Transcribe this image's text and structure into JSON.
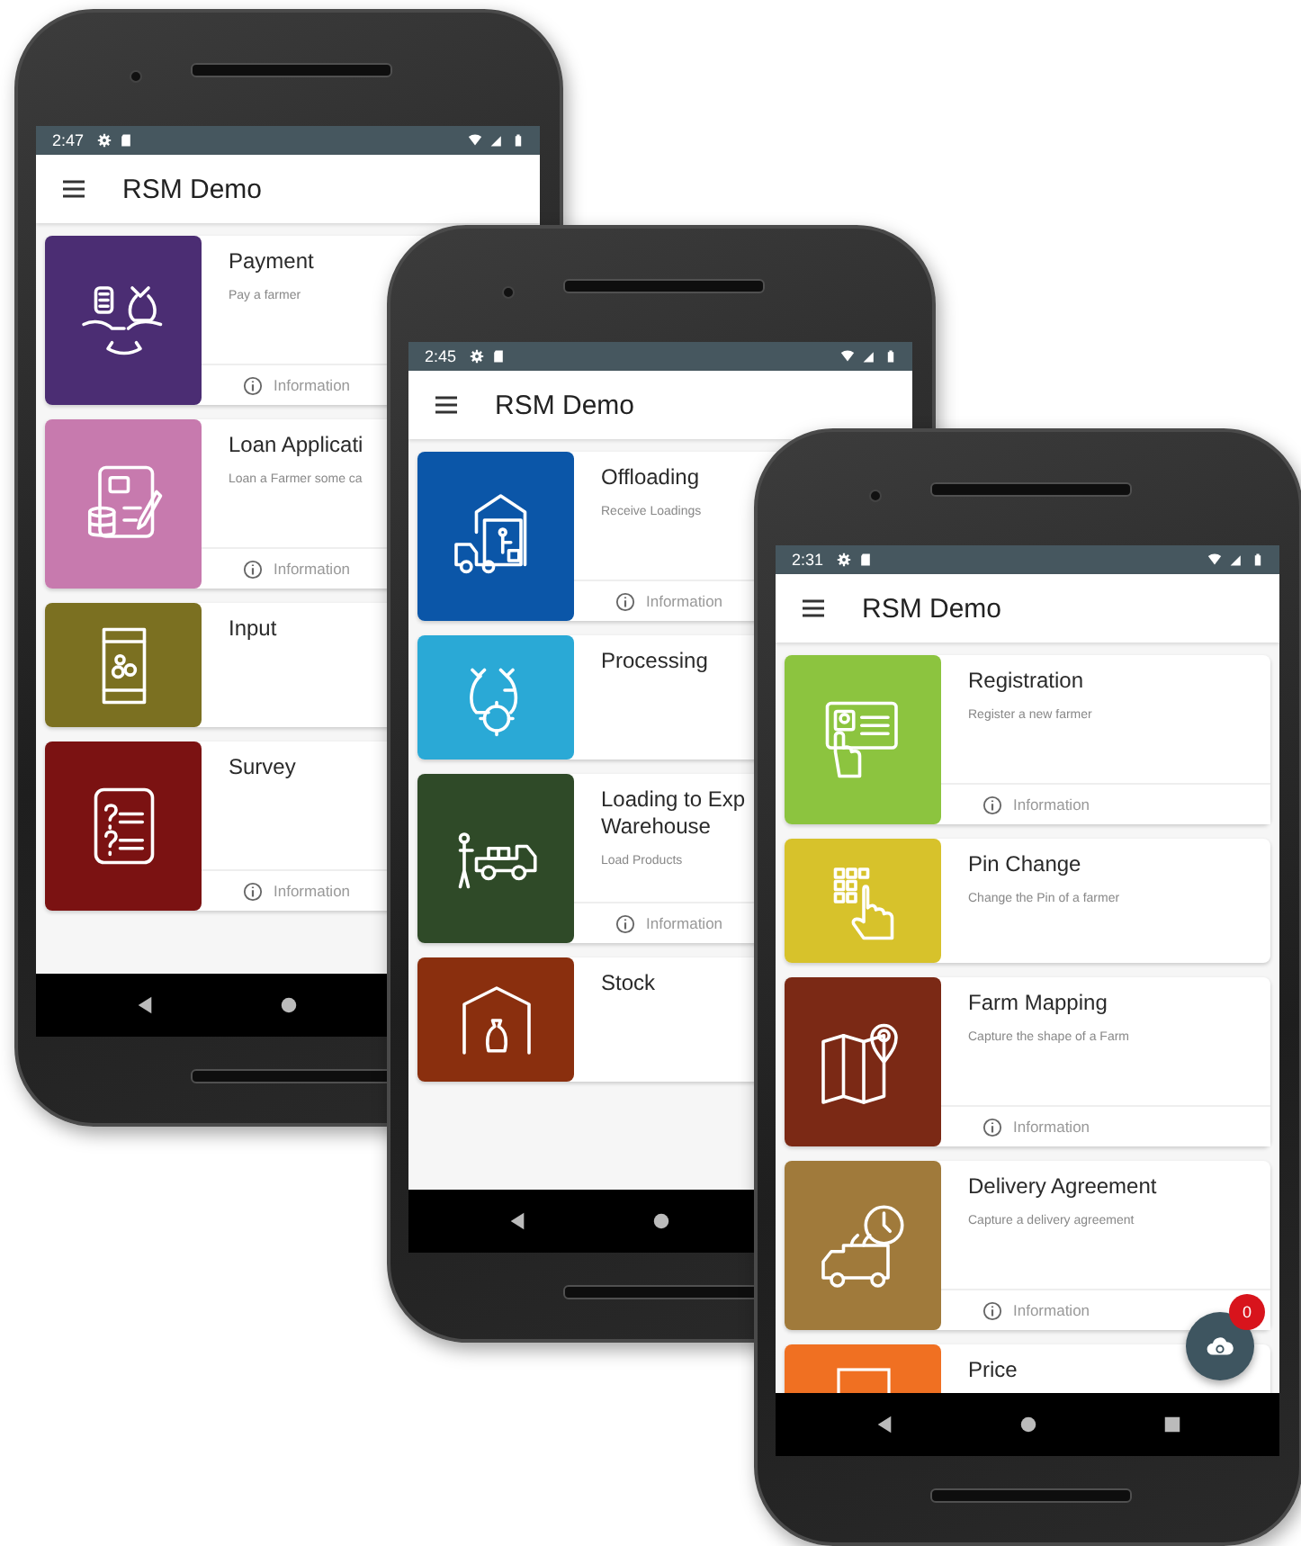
{
  "phones": [
    {
      "status_time": "2:47",
      "app_title": "RSM Demo",
      "cards": [
        {
          "title": "Payment",
          "subtitle": "Pay a farmer",
          "info": "Information",
          "color": "#4b2d73"
        },
        {
          "title": "Loan Applicati",
          "subtitle": "Loan a Farmer some ca",
          "info": "Information",
          "color": "#c77aae"
        },
        {
          "title": "Input",
          "color": "#7b7021"
        },
        {
          "title": "Survey",
          "info": "Information",
          "color": "#7b1212"
        }
      ],
      "nav_buttons": [
        {
          "kind": "back"
        },
        {
          "kind": "home"
        }
      ]
    },
    {
      "status_time": "2:45",
      "app_title": "RSM Demo",
      "cards": [
        {
          "title": "Offloading",
          "subtitle": "Receive Loadings",
          "info": "Information",
          "color": "#0b56a8"
        },
        {
          "title": "Processing",
          "color": "#2aa9d6"
        },
        {
          "title": "Loading to Exp\nWarehouse",
          "subtitle": "Load Products",
          "info": "Information",
          "color": "#2f4a28"
        },
        {
          "title": "Stock",
          "color": "#8a2f0e"
        }
      ],
      "nav_buttons": [
        {
          "kind": "back"
        },
        {
          "kind": "home"
        }
      ]
    },
    {
      "status_time": "2:31",
      "app_title": "RSM Demo",
      "cards": [
        {
          "title": "Registration",
          "subtitle": "Register a new farmer",
          "info": "Information",
          "color": "#8cc43f"
        },
        {
          "title": "Pin Change",
          "subtitle": "Change the Pin of a farmer",
          "color": "#d7c22b"
        },
        {
          "title": "Farm Mapping",
          "subtitle": "Capture the shape of a Farm",
          "info": "Information",
          "color": "#7b2915"
        },
        {
          "title": "Delivery Agreement",
          "subtitle": "Capture a delivery agreement",
          "info": "Information",
          "color": "#a07a3b"
        },
        {
          "title": "Price",
          "color": "#f07022"
        }
      ],
      "nav_buttons": [
        {
          "kind": "back"
        },
        {
          "kind": "home"
        },
        {
          "kind": "recents"
        }
      ],
      "sync_button": {
        "badge": "0"
      }
    }
  ]
}
